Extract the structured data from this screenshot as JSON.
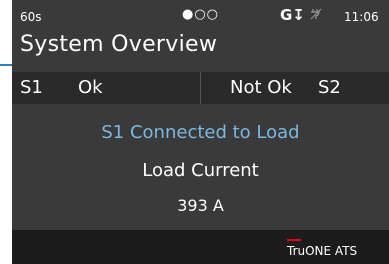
{
  "status_bar": {
    "timer": "60s",
    "page_dots": "●○○",
    "generator_symbol": "G↧",
    "icons": [
      "generator-icon",
      "plug-icon"
    ],
    "time": "11:06"
  },
  "title": "System Overview",
  "sources": {
    "s1": {
      "label": "S1",
      "status": "Ok"
    },
    "s2": {
      "label": "S2",
      "status": "Not Ok"
    }
  },
  "main": {
    "connection_text": "S1 Connected to Load",
    "load_label": "Load Current",
    "load_value": "393 A"
  },
  "footer": {
    "brand": "TruONE ATS"
  },
  "colors": {
    "background": "#3a3a3a",
    "source_bar": "#2a2a2a",
    "footer": "#1c1c1c",
    "accent_blue": "#7cb8e0",
    "brand_red": "#e3001b"
  }
}
